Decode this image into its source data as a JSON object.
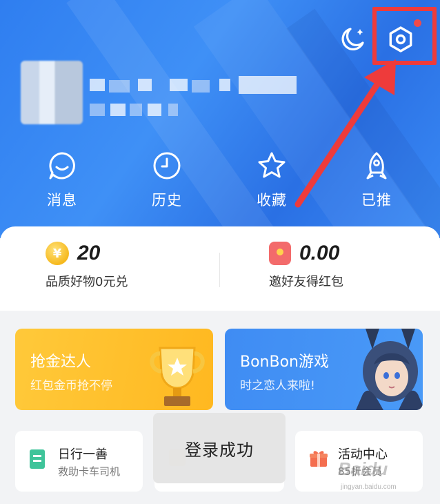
{
  "quick_nav": [
    {
      "label": "消息",
      "icon": "chat-smile-icon"
    },
    {
      "label": "历史",
      "icon": "clock-icon"
    },
    {
      "label": "收藏",
      "icon": "star-icon"
    },
    {
      "label": "已推",
      "icon": "rocket-icon"
    }
  ],
  "stats": {
    "coins": {
      "value": "20",
      "desc": "品质好物0元兑",
      "badge": "¥"
    },
    "redpacket": {
      "value": "0.00",
      "desc": "邀好友得红包"
    }
  },
  "promos": {
    "gold": {
      "title": "抢金达人",
      "subtitle": "红包金币抢不停"
    },
    "game": {
      "title": "BonBon游戏",
      "subtitle": "时之恋人来啦!"
    }
  },
  "small_cards": {
    "charity": {
      "title": "日行一善",
      "subtitle": "救助卡车司机"
    },
    "activity": {
      "title": "活动中心",
      "subtitle": "85折会员"
    }
  },
  "toast": "登录成功",
  "watermark": {
    "logo": "Baidu",
    "url": "jingyan.baidu.com"
  },
  "colors": {
    "header_blue": "#2f7ef0",
    "highlight_red": "#ee3b3b",
    "gold": "#ffc93a",
    "game_blue": "#3f8cf3"
  }
}
